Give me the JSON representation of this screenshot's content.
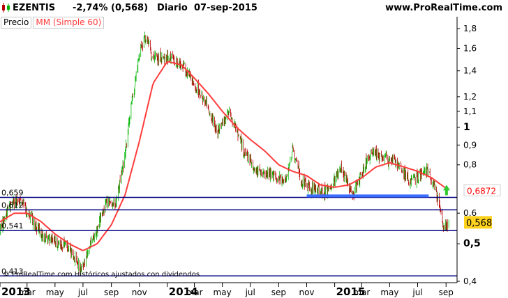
{
  "header": {
    "symbol": "EZENTIS",
    "change": "-2,74% (0,568)",
    "period": "Diario",
    "date": "07-sep-2015",
    "site": "www.ProRealTime.com"
  },
  "legend": {
    "price_label": "Precio",
    "ma_label": "MM (Simple 60)"
  },
  "footer": {
    "copyright": "© ProRealTime.com Históricos ajustados con dividendos"
  },
  "colors": {
    "up": "#00b400",
    "down": "#b40000",
    "ma": "#ff3c3c",
    "hline": "#000080",
    "blue_bar": "#3a6cff",
    "last_price_bg": "#ffd21e",
    "ma_value": "#ff0000",
    "arrow": "#32c832",
    "grid": "#c0c0c0"
  },
  "chart_data": {
    "type": "candlestick",
    "y_scale": "log",
    "ylim": [
      0.4,
      1.9
    ],
    "y_ticks": [
      {
        "v": 1.8,
        "label": "1,8",
        "bold": false
      },
      {
        "v": 1.6,
        "label": "1,6",
        "bold": false
      },
      {
        "v": 1.4,
        "label": "1,4",
        "bold": false
      },
      {
        "v": 1.2,
        "label": "1,2",
        "bold": false
      },
      {
        "v": 1.1,
        "label": "1,1",
        "bold": false
      },
      {
        "v": 1.0,
        "label": "1",
        "bold": true
      },
      {
        "v": 0.9,
        "label": "0,9",
        "bold": false
      },
      {
        "v": 0.8,
        "label": "0,8",
        "bold": false
      },
      {
        "v": 0.6,
        "label": "0,6",
        "bold": false
      },
      {
        "v": 0.5,
        "label": "0,5",
        "bold": true
      },
      {
        "v": 0.4,
        "label": "0,4",
        "bold": false
      }
    ],
    "x_range": [
      "2013-01-01",
      "2015-09-25"
    ],
    "x_ticks": [
      {
        "date": "2013-01-01",
        "label": "2013",
        "bold": true
      },
      {
        "date": "2013-03-01",
        "label": "mar",
        "bold": false
      },
      {
        "date": "2013-05-01",
        "label": "may",
        "bold": false
      },
      {
        "date": "2013-07-01",
        "label": "jul",
        "bold": false
      },
      {
        "date": "2013-09-01",
        "label": "sep",
        "bold": false
      },
      {
        "date": "2013-11-01",
        "label": "nov",
        "bold": false
      },
      {
        "date": "2014-01-01",
        "label": "2014",
        "bold": true
      },
      {
        "date": "2014-03-01",
        "label": "mar",
        "bold": false
      },
      {
        "date": "2014-05-01",
        "label": "may",
        "bold": false
      },
      {
        "date": "2014-07-01",
        "label": "jul",
        "bold": false
      },
      {
        "date": "2014-09-01",
        "label": "sep",
        "bold": false
      },
      {
        "date": "2014-11-01",
        "label": "nov",
        "bold": false
      },
      {
        "date": "2015-01-01",
        "label": "2015",
        "bold": true
      },
      {
        "date": "2015-03-01",
        "label": "mar",
        "bold": false
      },
      {
        "date": "2015-05-01",
        "label": "may",
        "bold": false
      },
      {
        "date": "2015-07-01",
        "label": "jul",
        "bold": false
      },
      {
        "date": "2015-09-01",
        "label": "sep",
        "bold": false
      }
    ],
    "price_path": [
      [
        "2013-01-01",
        0.54
      ],
      [
        "2013-01-20",
        0.62
      ],
      [
        "2013-02-10",
        0.66
      ],
      [
        "2013-03-01",
        0.61
      ],
      [
        "2013-04-01",
        0.53
      ],
      [
        "2013-05-01",
        0.51
      ],
      [
        "2013-06-01",
        0.49
      ],
      [
        "2013-06-25",
        0.43
      ],
      [
        "2013-07-10",
        0.47
      ],
      [
        "2013-08-01",
        0.55
      ],
      [
        "2013-08-20",
        0.64
      ],
      [
        "2013-09-10",
        0.63
      ],
      [
        "2013-10-01",
        0.85
      ],
      [
        "2013-10-10",
        1.05
      ],
      [
        "2013-11-01",
        1.55
      ],
      [
        "2013-11-15",
        1.72
      ],
      [
        "2013-12-01",
        1.5
      ],
      [
        "2014-01-01",
        1.52
      ],
      [
        "2014-02-01",
        1.46
      ],
      [
        "2014-03-01",
        1.3
      ],
      [
        "2014-04-01",
        1.12
      ],
      [
        "2014-04-20",
        0.97
      ],
      [
        "2014-05-15",
        1.1
      ],
      [
        "2014-06-15",
        0.88
      ],
      [
        "2014-07-15",
        0.77
      ],
      [
        "2014-08-15",
        0.76
      ],
      [
        "2014-09-15",
        0.72
      ],
      [
        "2014-10-01",
        0.87
      ],
      [
        "2014-10-20",
        0.73
      ],
      [
        "2014-11-10",
        0.7
      ],
      [
        "2014-12-15",
        0.68
      ],
      [
        "2015-01-15",
        0.78
      ],
      [
        "2015-02-10",
        0.67
      ],
      [
        "2015-03-01",
        0.76
      ],
      [
        "2015-03-20",
        0.86
      ],
      [
        "2015-04-15",
        0.83
      ],
      [
        "2015-05-15",
        0.82
      ],
      [
        "2015-06-15",
        0.72
      ],
      [
        "2015-07-20",
        0.78
      ],
      [
        "2015-08-10",
        0.69
      ],
      [
        "2015-08-25",
        0.55
      ],
      [
        "2015-09-07",
        0.568
      ]
    ],
    "ma_path": [
      [
        "2013-01-01",
        0.57
      ],
      [
        "2013-02-01",
        0.6
      ],
      [
        "2013-03-01",
        0.6
      ],
      [
        "2013-04-01",
        0.57
      ],
      [
        "2013-05-01",
        0.53
      ],
      [
        "2013-06-01",
        0.5
      ],
      [
        "2013-07-01",
        0.48
      ],
      [
        "2013-08-01",
        0.5
      ],
      [
        "2013-09-01",
        0.56
      ],
      [
        "2013-10-01",
        0.67
      ],
      [
        "2013-11-01",
        0.92
      ],
      [
        "2013-12-01",
        1.3
      ],
      [
        "2014-01-01",
        1.48
      ],
      [
        "2014-02-01",
        1.45
      ],
      [
        "2014-03-01",
        1.34
      ],
      [
        "2014-04-01",
        1.22
      ],
      [
        "2014-05-01",
        1.1
      ],
      [
        "2014-06-01",
        1.0
      ],
      [
        "2014-07-01",
        0.93
      ],
      [
        "2014-08-01",
        0.87
      ],
      [
        "2014-09-01",
        0.8
      ],
      [
        "2014-10-01",
        0.77
      ],
      [
        "2014-11-01",
        0.75
      ],
      [
        "2014-12-01",
        0.71
      ],
      [
        "2015-01-01",
        0.7
      ],
      [
        "2015-02-01",
        0.71
      ],
      [
        "2015-03-01",
        0.74
      ],
      [
        "2015-04-01",
        0.79
      ],
      [
        "2015-05-01",
        0.81
      ],
      [
        "2015-06-01",
        0.79
      ],
      [
        "2015-07-01",
        0.77
      ],
      [
        "2015-08-01",
        0.74
      ],
      [
        "2015-09-07",
        0.687
      ]
    ],
    "hlines": [
      {
        "value": 0.659,
        "label": "0,659"
      },
      {
        "value": 0.612,
        "label": "0,612"
      },
      {
        "value": 0.541,
        "label": "0,541"
      },
      {
        "value": 0.413,
        "label": "0,413"
      }
    ],
    "support_bar": {
      "value": 0.665,
      "from": "2014-11-01",
      "to": "2015-07-25"
    },
    "last_ma_value": {
      "value": 0.6872,
      "label": "0,6872"
    },
    "last_price": {
      "value": 0.568,
      "label": "0,568"
    },
    "arrow_date": "2015-09-02"
  }
}
